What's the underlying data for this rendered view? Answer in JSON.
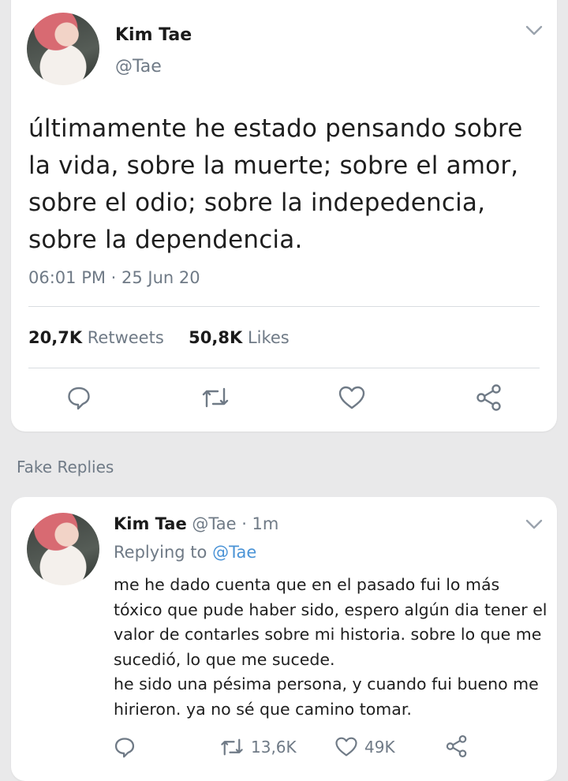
{
  "tweet": {
    "author_name": "Kim Tae",
    "author_handle": "@Tae",
    "text": "últimamente he estado pensando sobre la vida, sobre la muerte; sobre el amor, sobre el odio; sobre la indepedencia, sobre la dependencia.",
    "timestamp": "06:01 PM · 25 Jun 20",
    "retweets_count": "20,7K",
    "retweets_label": "Retweets",
    "likes_count": "50,8K",
    "likes_label": "Likes",
    "actions": [
      "reply-icon",
      "retweet-icon",
      "like-icon",
      "share-icon"
    ]
  },
  "section": {
    "title": "Fake Replies"
  },
  "reply": {
    "author_name": "Kim Tae",
    "author_handle": "@Tae · 1m",
    "replying_prefix": "Replying to",
    "replying_to": "@Tae",
    "text": "me he dado cuenta que en el pasado fui lo más tóxico que pude haber sido, espero algún dia tener el valor de contarles sobre mi historia. sobre lo que me sucedió, lo que me sucede.\nhe sido una pésima persona, y cuando fui bueno me hirieron. ya no sé que camino tomar.",
    "retweets_count": "13,6K",
    "likes_count": "49K"
  },
  "colors": {
    "background": "#e9e9ea",
    "card": "#ffffff",
    "secondary_text": "#6f7a86",
    "link": "#4a93d6"
  }
}
